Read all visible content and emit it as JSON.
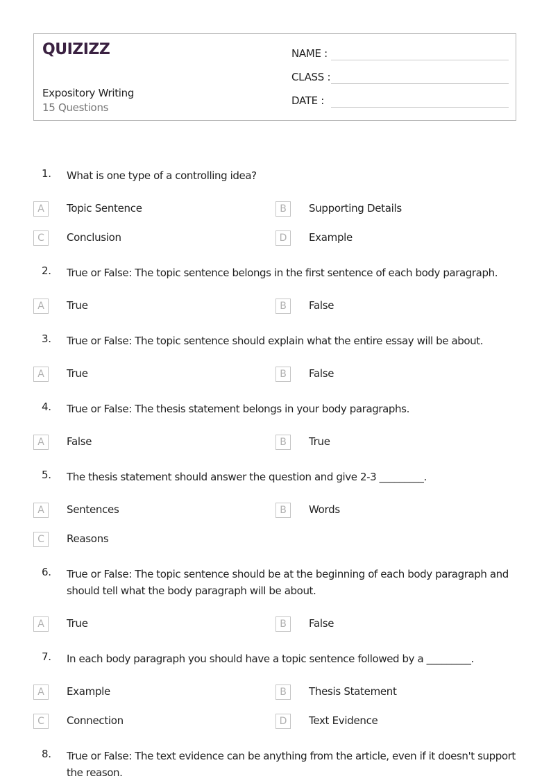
{
  "header": {
    "logo": "QUIZIZZ",
    "title": "Expository Writing",
    "question_count": "15 Questions",
    "fields": [
      {
        "label": "NAME :"
      },
      {
        "label": "CLASS :"
      },
      {
        "label": "DATE  :"
      }
    ]
  },
  "questions": [
    {
      "number": "1.",
      "text": "What is one type of a controlling idea?",
      "options": [
        {
          "letter": "A",
          "text": "Topic Sentence"
        },
        {
          "letter": "B",
          "text": "Supporting Details"
        },
        {
          "letter": "C",
          "text": "Conclusion"
        },
        {
          "letter": "D",
          "text": "Example"
        }
      ]
    },
    {
      "number": "2.",
      "text": "True or False: The topic sentence belongs in the first sentence of each body paragraph.",
      "options": [
        {
          "letter": "A",
          "text": "True"
        },
        {
          "letter": "B",
          "text": "False"
        }
      ]
    },
    {
      "number": "3.",
      "text": "True or False: The topic sentence should explain what the entire essay will be about.",
      "options": [
        {
          "letter": "A",
          "text": "True"
        },
        {
          "letter": "B",
          "text": "False"
        }
      ]
    },
    {
      "number": "4.",
      "text": "True or False: The thesis statement belongs in your body paragraphs.",
      "options": [
        {
          "letter": "A",
          "text": "False"
        },
        {
          "letter": "B",
          "text": "True"
        }
      ]
    },
    {
      "number": "5.",
      "text": "The thesis statement should answer the question and give 2-3 _________.",
      "options": [
        {
          "letter": "A",
          "text": "Sentences"
        },
        {
          "letter": "B",
          "text": "Words"
        },
        {
          "letter": "C",
          "text": "Reasons"
        }
      ]
    },
    {
      "number": "6.",
      "text": "True or False: The topic sentence should be at the beginning of each body paragraph and should tell what the body paragraph will be about.",
      "options": [
        {
          "letter": "A",
          "text": "True"
        },
        {
          "letter": "B",
          "text": "False"
        }
      ]
    },
    {
      "number": "7.",
      "text": "In each body paragraph you should have a topic sentence followed by a _________.",
      "options": [
        {
          "letter": "A",
          "text": "Example"
        },
        {
          "letter": "B",
          "text": "Thesis Statement"
        },
        {
          "letter": "C",
          "text": "Connection"
        },
        {
          "letter": "D",
          "text": "Text Evidence"
        }
      ]
    },
    {
      "number": "8.",
      "text": "True or False: The text evidence can be anything from the article, even if it doesn't support the reason.",
      "options": []
    }
  ],
  "colors": {
    "logo": "#3a2141",
    "border": "#b5b5b5",
    "option_letter": "#b0b0b0"
  }
}
